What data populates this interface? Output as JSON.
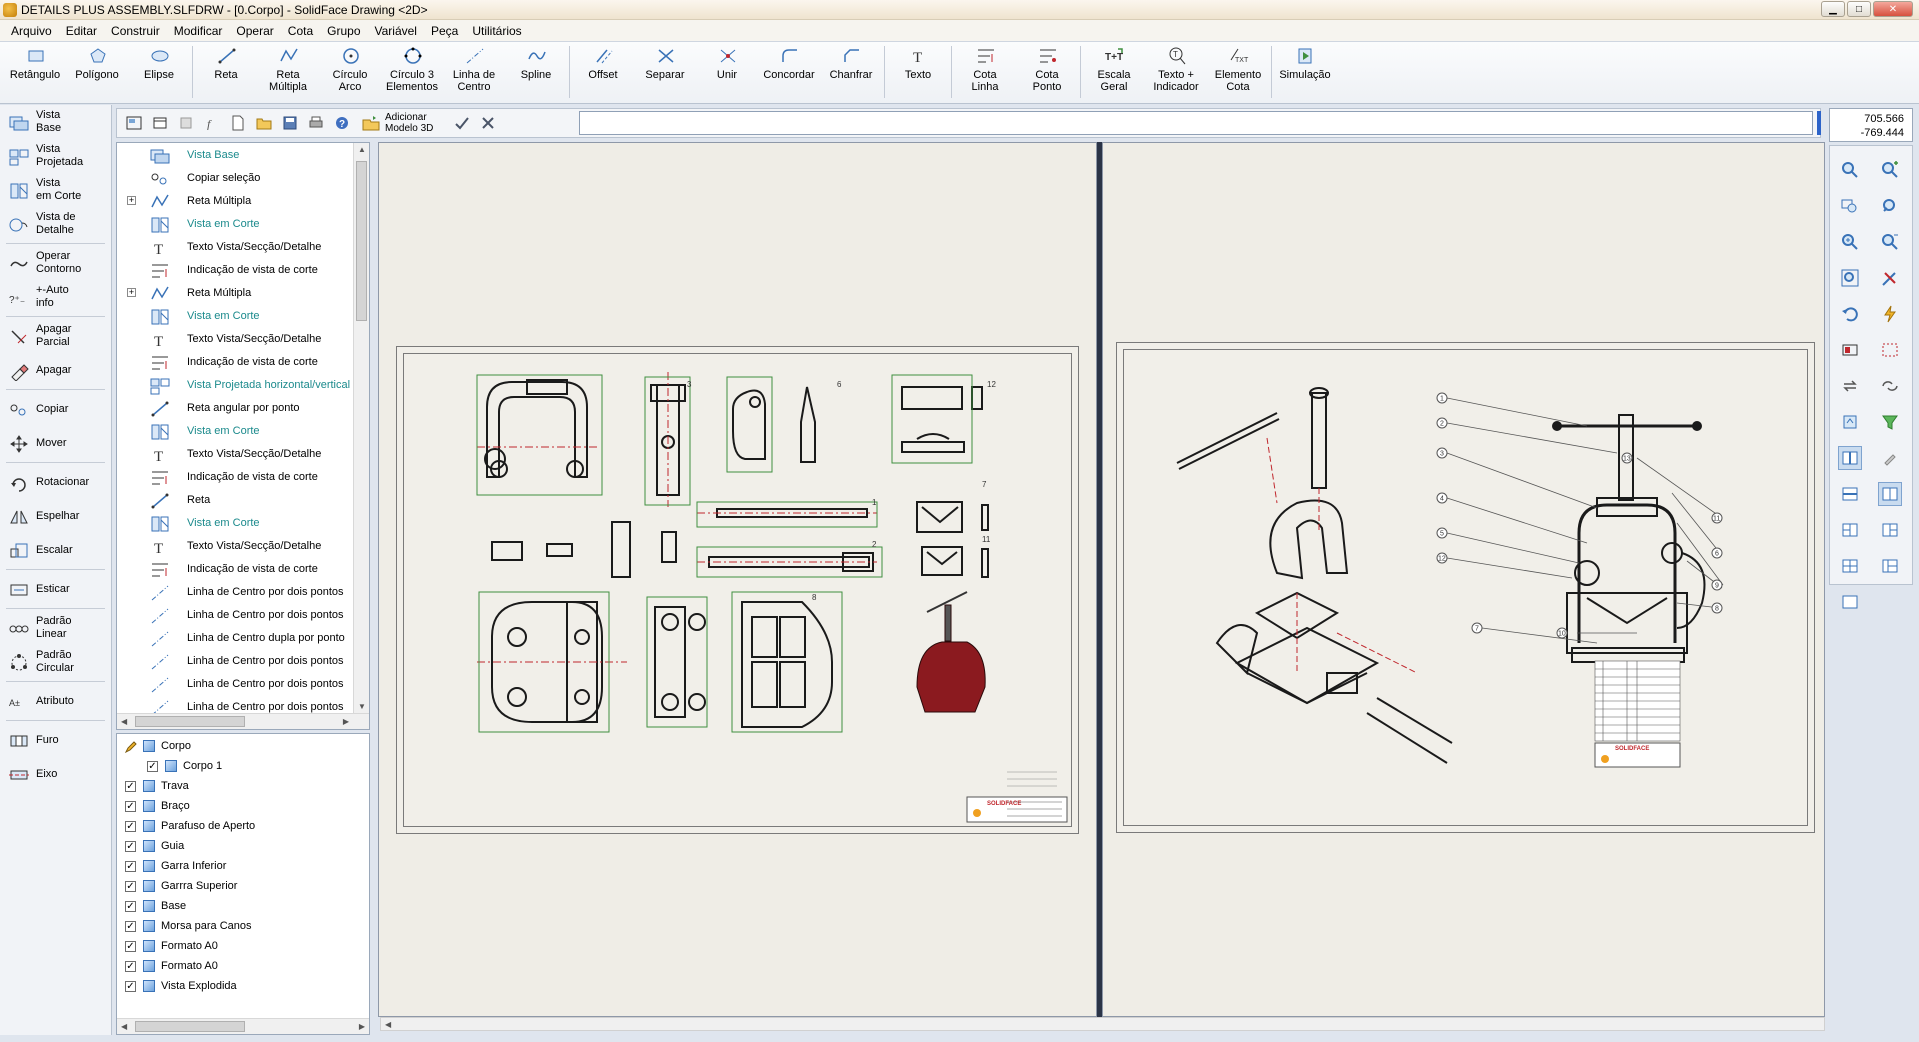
{
  "window": {
    "title": "DETAILS PLUS ASSEMBLY.SLFDRW - [0.Corpo] - SolidFace Drawing <2D>",
    "buttons": {
      "minimize": "▁",
      "maximize": "□",
      "close": "✕"
    }
  },
  "menu": [
    "Arquivo",
    "Editar",
    "Construir",
    "Modificar",
    "Operar",
    "Cota",
    "Grupo",
    "Variável",
    "Peça",
    "Utilitários"
  ],
  "ribbon": [
    {
      "label": "Retângulo",
      "icon": "rectangle-icon"
    },
    {
      "label": "Polígono",
      "icon": "polygon-icon"
    },
    {
      "label": "Elipse",
      "icon": "ellipse-icon"
    },
    {
      "label": "Reta",
      "icon": "line-icon"
    },
    {
      "label": "Reta\nMúltipla",
      "icon": "polyline-icon"
    },
    {
      "label": "Círculo\nArco",
      "icon": "circle-arc-icon"
    },
    {
      "label": "Círculo 3\nElementos",
      "icon": "circle-3-icon"
    },
    {
      "label": "Linha de\nCentro",
      "icon": "center-line-icon"
    },
    {
      "label": "Spline",
      "icon": "spline-icon"
    },
    {
      "label": "Offset",
      "icon": "offset-icon"
    },
    {
      "label": "Separar",
      "icon": "separate-icon"
    },
    {
      "label": "Unir",
      "icon": "join-icon"
    },
    {
      "label": "Concordar",
      "icon": "fillet-icon"
    },
    {
      "label": "Chanfrar",
      "icon": "chamfer-icon"
    },
    {
      "label": "Texto",
      "icon": "text-icon"
    },
    {
      "label": "Cota\nLinha",
      "icon": "dim-line-icon"
    },
    {
      "label": "Cota\nPonto",
      "icon": "dim-point-icon"
    },
    {
      "label": "Escala\nGeral",
      "icon": "scale-icon"
    },
    {
      "label": "Texto +\nIndicador",
      "icon": "leader-text-icon"
    },
    {
      "label": "Elemento\nCota",
      "icon": "dim-element-icon"
    },
    {
      "label": "Simulação",
      "icon": "simulation-icon"
    }
  ],
  "left_tools": [
    {
      "label": "Vista\nBase",
      "icon": "base-view-icon"
    },
    {
      "label": "Vista\nProjetada",
      "icon": "projected-view-icon"
    },
    {
      "label": "Vista\nem Corte",
      "icon": "section-view-icon"
    },
    {
      "label": "Vista de\nDetalhe",
      "icon": "detail-view-icon"
    },
    {
      "label": "Operar\nContorno",
      "icon": "contour-icon"
    },
    {
      "label": "+-Auto\ninfo",
      "icon": "auto-info-icon"
    },
    {
      "label": "Apagar\nParcial",
      "icon": "partial-erase-icon"
    },
    {
      "label": "Apagar",
      "icon": "erase-icon"
    },
    {
      "label": "Copiar",
      "icon": "copy-icon"
    },
    {
      "label": "Mover",
      "icon": "move-icon"
    },
    {
      "label": "Rotacionar",
      "icon": "rotate-icon"
    },
    {
      "label": "Espelhar",
      "icon": "mirror-icon"
    },
    {
      "label": "Escalar",
      "icon": "scale-tool-icon"
    },
    {
      "label": "Esticar",
      "icon": "stretch-icon"
    },
    {
      "label": "Padrão\nLinear",
      "icon": "linear-pattern-icon"
    },
    {
      "label": "Padrão\nCircular",
      "icon": "circular-pattern-icon"
    },
    {
      "label": "Atributo",
      "icon": "attribute-icon"
    },
    {
      "label": "Furo",
      "icon": "hole-icon"
    },
    {
      "label": "Eixo",
      "icon": "axis-icon"
    }
  ],
  "toolbar2": {
    "add_model": "Adicionar\nModelo 3D",
    "command_value": ""
  },
  "coords": {
    "x": "705.566",
    "y": "-769.444"
  },
  "history_tree": [
    {
      "label": "Vista Base",
      "teal": true,
      "expand": false
    },
    {
      "label": "Copiar seleção",
      "teal": false,
      "expand": false
    },
    {
      "label": "Reta Múltipla",
      "teal": false,
      "expand": true
    },
    {
      "label": "Vista em Corte",
      "teal": true,
      "expand": false
    },
    {
      "label": "Texto Vista/Secção/Detalhe",
      "teal": false,
      "expand": false
    },
    {
      "label": "Indicação de vista de corte",
      "teal": false,
      "expand": false
    },
    {
      "label": "Reta Múltipla",
      "teal": false,
      "expand": true
    },
    {
      "label": "Vista em Corte",
      "teal": true,
      "expand": false
    },
    {
      "label": "Texto Vista/Secção/Detalhe",
      "teal": false,
      "expand": false
    },
    {
      "label": "Indicação de vista de corte",
      "teal": false,
      "expand": false
    },
    {
      "label": "Vista Projetada horizontal/vertical",
      "teal": true,
      "expand": false
    },
    {
      "label": "Reta angular por ponto",
      "teal": false,
      "expand": false
    },
    {
      "label": "Vista em Corte",
      "teal": true,
      "expand": false
    },
    {
      "label": "Texto Vista/Secção/Detalhe",
      "teal": false,
      "expand": false
    },
    {
      "label": "Indicação de vista de corte",
      "teal": false,
      "expand": false
    },
    {
      "label": "Reta",
      "teal": false,
      "expand": false
    },
    {
      "label": "Vista em Corte",
      "teal": true,
      "expand": false
    },
    {
      "label": "Texto Vista/Secção/Detalhe",
      "teal": false,
      "expand": false
    },
    {
      "label": "Indicação de vista de corte",
      "teal": false,
      "expand": false
    },
    {
      "label": "Linha de Centro por dois pontos",
      "teal": false,
      "expand": false
    },
    {
      "label": "Linha de Centro por dois pontos",
      "teal": false,
      "expand": false
    },
    {
      "label": "Linha de Centro dupla por ponto",
      "teal": false,
      "expand": false
    },
    {
      "label": "Linha de Centro por dois pontos",
      "teal": false,
      "expand": false
    },
    {
      "label": "Linha de Centro por dois pontos",
      "teal": false,
      "expand": false
    },
    {
      "label": "Linha de Centro por dois pontos",
      "teal": false,
      "expand": false
    }
  ],
  "layers": [
    {
      "label": "Corpo",
      "indent": 0,
      "check": "pencil"
    },
    {
      "label": "Corpo 1",
      "indent": 1,
      "check": "checked"
    },
    {
      "label": "Trava",
      "indent": 0,
      "check": "checked"
    },
    {
      "label": "Braço",
      "indent": 0,
      "check": "checked"
    },
    {
      "label": "Parafuso de Aperto",
      "indent": 0,
      "check": "checked"
    },
    {
      "label": "Guia",
      "indent": 0,
      "check": "checked"
    },
    {
      "label": "Garra Inferior",
      "indent": 0,
      "check": "checked"
    },
    {
      "label": "Garrra Superior",
      "indent": 0,
      "check": "checked"
    },
    {
      "label": "Base",
      "indent": 0,
      "check": "checked"
    },
    {
      "label": "Morsa para Canos",
      "indent": 0,
      "check": "checked"
    },
    {
      "label": "Formato A0",
      "indent": 0,
      "check": "checked"
    },
    {
      "label": "Formato A0",
      "indent": 0,
      "check": "checked"
    },
    {
      "label": "Vista Explodida",
      "indent": 0,
      "check": "checked"
    }
  ],
  "colors": {
    "accent": "#1b8a8c",
    "sheet": "#f1efe9",
    "divider": "#2b3447",
    "drawing_stroke": "#1a1a1a",
    "drawing_red": "#c0272d",
    "dimension_green": "#3f8f3f"
  },
  "drawing_left": {
    "view_labels": [
      "3",
      "6",
      "12",
      "1",
      "7",
      "2",
      "11",
      "8"
    ],
    "logo": "SOLIDFACE"
  },
  "drawing_right": {
    "balloons": [
      "1",
      "2",
      "3",
      "13",
      "4",
      "5",
      "12",
      "11",
      "6",
      "9",
      "8",
      "7",
      "10"
    ],
    "logo": "SOLIDFACE"
  }
}
